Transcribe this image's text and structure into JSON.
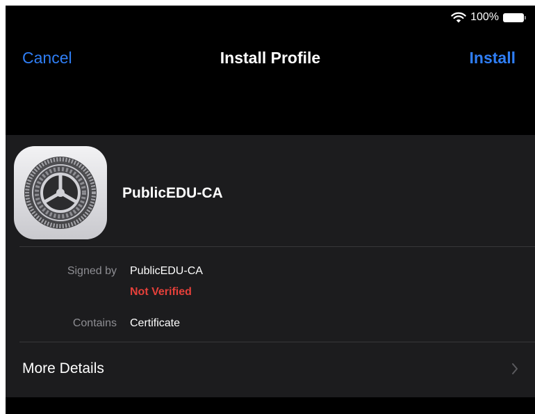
{
  "status_bar": {
    "battery": "100%",
    "icons": [
      "wifi-icon",
      "battery-icon"
    ]
  },
  "nav": {
    "cancel_label": "Cancel",
    "title": "Install Profile",
    "install_label": "Install"
  },
  "profile": {
    "icon": "settings-gear-icon",
    "name": "PublicEDU-CA",
    "signed_by_label": "Signed by",
    "signed_by_value": "PublicEDU-CA",
    "verification_status": "Not Verified",
    "contains_label": "Contains",
    "contains_value": "Certificate"
  },
  "more_details": {
    "label": "More Details",
    "icon": "chevron-right-icon"
  },
  "colors": {
    "background": "#000000",
    "card": "#1c1c1e",
    "accent_blue": "#2f7ef5",
    "warning_red": "#e5403a",
    "secondary_text": "#8e8e93"
  }
}
